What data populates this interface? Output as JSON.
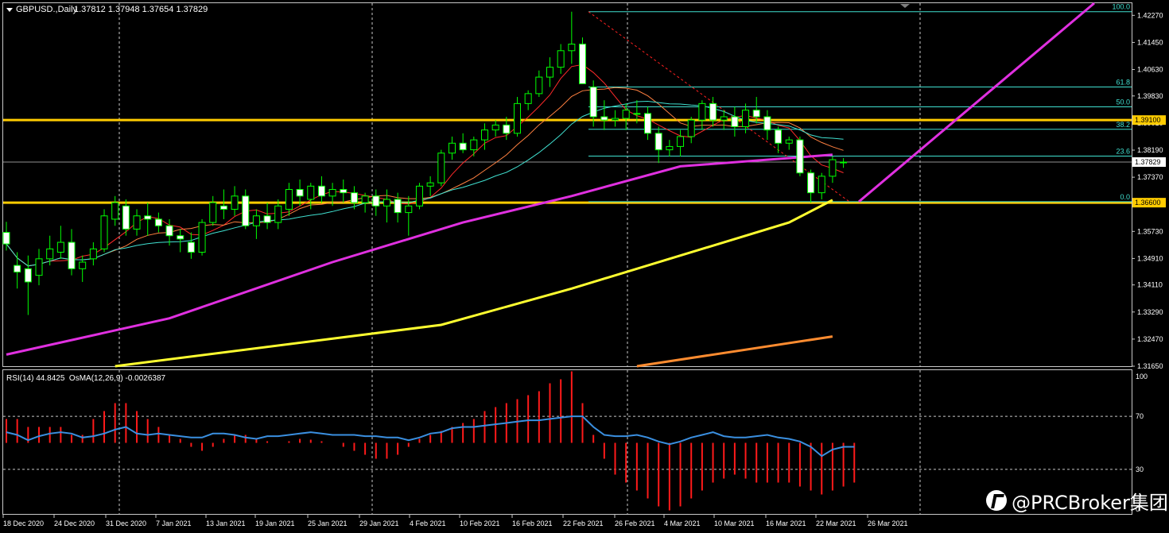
{
  "header": {
    "symbol_label": "GBPUSD.,Daily",
    "ohlc_label": "1.37812 1.37948 1.37654 1.37829"
  },
  "indicator_header": "RSI(14) 44.8425  OsMA(12,26,9) -0.0026387",
  "watermark": "@PRCBroker集团",
  "colors": {
    "background": "#000000",
    "candle_up": "#000000",
    "candle_down": "#ffffff",
    "wick": "#00ff00",
    "ma_fast": "#ff2a2a",
    "ma_mid": "#ff8040",
    "ma_slow_cyan": "#40e0d0",
    "ma_100": "#e030e0",
    "ma_200": "#ffff30",
    "ma_long": "#ff8c30",
    "support_line": "#ffcc00",
    "fib": "#40e0d0",
    "trendline": "#e030e0",
    "rsi": "#3a8fe0",
    "osma": "#ff1a1a",
    "price_tag": "#ffffff"
  },
  "chart_data": {
    "type": "candlestick",
    "symbol": "GBPUSD",
    "timeframe": "Daily",
    "price_axis": {
      "ticks": [
        1.4227,
        1.4145,
        1.4063,
        1.3983,
        1.3901,
        1.3819,
        1.3737,
        1.3655,
        1.3573,
        1.3491,
        1.3411,
        1.3329,
        1.3247,
        1.3165
      ],
      "tick_labels": [
        "1.42270",
        "1.41450",
        "1.40630",
        "1.39830",
        "1.39010",
        "1.38190",
        "1.37370",
        "1.36550",
        "1.35730",
        "1.34910",
        "1.34110",
        "1.33290",
        "1.32470",
        "1.31650"
      ],
      "range": [
        1.3165,
        1.4259
      ]
    },
    "date_labels": [
      "18 Dec 2020",
      "24 Dec 2020",
      "31 Dec 2020",
      "7 Jan 2021",
      "13 Jan 2021",
      "19 Jan 2021",
      "25 Jan 2021",
      "29 Jan 2021",
      "4 Feb 2021",
      "10 Feb 2021",
      "16 Feb 2021",
      "22 Feb 2021",
      "26 Feb 2021",
      "4 Mar 2021",
      "10 Mar 2021",
      "16 Mar 2021",
      "22 Mar 2021",
      "26 Mar 2021"
    ],
    "horizontal_levels": [
      {
        "value": 1.391,
        "label": "1.39100"
      },
      {
        "value": 1.366,
        "label": "1.36600"
      }
    ],
    "current_price": {
      "value": 1.37829,
      "label": "1.37829"
    },
    "fibonacci": {
      "levels": [
        {
          "label": "100.0",
          "value": 1.4238
        },
        {
          "label": "61.8",
          "value": 1.401
        },
        {
          "label": "50.0",
          "value": 1.395
        },
        {
          "label": "38.2",
          "value": 1.3882
        },
        {
          "label": "23.6",
          "value": 1.3801
        },
        {
          "label": "0.0",
          "value": 1.3663
        }
      ]
    },
    "candles": [
      [
        1.357,
        1.3602,
        1.3515,
        1.3535
      ],
      [
        1.347,
        1.351,
        1.34,
        1.345
      ],
      [
        1.346,
        1.35,
        1.332,
        1.342
      ],
      [
        1.344,
        1.352,
        1.341,
        1.349
      ],
      [
        1.349,
        1.356,
        1.347,
        1.352
      ],
      [
        1.351,
        1.359,
        1.349,
        1.354
      ],
      [
        1.354,
        1.358,
        1.344,
        1.346
      ],
      [
        1.346,
        1.35,
        1.342,
        1.348
      ],
      [
        1.349,
        1.354,
        1.347,
        1.352
      ],
      [
        1.352,
        1.364,
        1.351,
        1.362
      ],
      [
        1.361,
        1.368,
        1.359,
        1.366
      ],
      [
        1.365,
        1.367,
        1.356,
        1.358
      ],
      [
        1.358,
        1.364,
        1.356,
        1.362
      ],
      [
        1.362,
        1.366,
        1.356,
        1.361
      ],
      [
        1.361,
        1.363,
        1.357,
        1.359
      ],
      [
        1.359,
        1.361,
        1.353,
        1.356
      ],
      [
        1.356,
        1.358,
        1.351,
        1.355
      ],
      [
        1.354,
        1.357,
        1.349,
        1.351
      ],
      [
        1.351,
        1.361,
        1.35,
        1.36
      ],
      [
        1.36,
        1.368,
        1.359,
        1.366
      ],
      [
        1.365,
        1.37,
        1.361,
        1.364
      ],
      [
        1.364,
        1.371,
        1.362,
        1.368
      ],
      [
        1.368,
        1.37,
        1.358,
        1.359
      ],
      [
        1.359,
        1.364,
        1.355,
        1.362
      ],
      [
        1.362,
        1.366,
        1.358,
        1.36
      ],
      [
        1.36,
        1.367,
        1.358,
        1.365
      ],
      [
        1.364,
        1.372,
        1.362,
        1.37
      ],
      [
        1.37,
        1.373,
        1.365,
        1.368
      ],
      [
        1.367,
        1.372,
        1.364,
        1.371
      ],
      [
        1.371,
        1.374,
        1.366,
        1.368
      ],
      [
        1.368,
        1.372,
        1.365,
        1.37
      ],
      [
        1.37,
        1.373,
        1.366,
        1.369
      ],
      [
        1.369,
        1.371,
        1.364,
        1.366
      ],
      [
        1.366,
        1.369,
        1.363,
        1.368
      ],
      [
        1.368,
        1.37,
        1.362,
        1.365
      ],
      [
        1.365,
        1.37,
        1.36,
        1.367
      ],
      [
        1.367,
        1.369,
        1.36,
        1.363
      ],
      [
        1.363,
        1.368,
        1.356,
        1.365
      ],
      [
        1.365,
        1.372,
        1.364,
        1.371
      ],
      [
        1.371,
        1.374,
        1.368,
        1.372
      ],
      [
        1.372,
        1.382,
        1.371,
        1.381
      ],
      [
        1.381,
        1.386,
        1.379,
        1.384
      ],
      [
        1.384,
        1.387,
        1.381,
        1.382
      ],
      [
        1.382,
        1.386,
        1.38,
        1.385
      ],
      [
        1.385,
        1.39,
        1.382,
        1.388
      ],
      [
        1.388,
        1.391,
        1.386,
        1.3895
      ],
      [
        1.3895,
        1.392,
        1.385,
        1.387
      ],
      [
        1.387,
        1.398,
        1.386,
        1.396
      ],
      [
        1.396,
        1.4,
        1.394,
        1.399
      ],
      [
        1.399,
        1.406,
        1.398,
        1.404
      ],
      [
        1.404,
        1.41,
        1.401,
        1.407
      ],
      [
        1.407,
        1.414,
        1.405,
        1.412
      ],
      [
        1.412,
        1.4238,
        1.408,
        1.414
      ],
      [
        1.414,
        1.416,
        1.403,
        1.402
      ],
      [
        1.401,
        1.403,
        1.389,
        1.392
      ],
      [
        1.392,
        1.397,
        1.388,
        1.391
      ],
      [
        1.391,
        1.394,
        1.389,
        1.3915
      ],
      [
        1.3915,
        1.396,
        1.388,
        1.394
      ],
      [
        1.393,
        1.397,
        1.39,
        1.393
      ],
      [
        1.393,
        1.395,
        1.385,
        1.387
      ],
      [
        1.387,
        1.389,
        1.378,
        1.382
      ],
      [
        1.382,
        1.385,
        1.38,
        1.383
      ],
      [
        1.383,
        1.388,
        1.38,
        1.386
      ],
      [
        1.386,
        1.392,
        1.384,
        1.391
      ],
      [
        1.391,
        1.397,
        1.388,
        1.396
      ],
      [
        1.396,
        1.398,
        1.389,
        1.391
      ],
      [
        1.391,
        1.394,
        1.388,
        1.392
      ],
      [
        1.392,
        1.395,
        1.386,
        1.389
      ],
      [
        1.389,
        1.396,
        1.387,
        1.394
      ],
      [
        1.394,
        1.398,
        1.39,
        1.392
      ],
      [
        1.392,
        1.394,
        1.385,
        1.388
      ],
      [
        1.388,
        1.389,
        1.381,
        1.384
      ],
      [
        1.384,
        1.386,
        1.382,
        1.385
      ],
      [
        1.385,
        1.386,
        1.374,
        1.375
      ],
      [
        1.375,
        1.376,
        1.366,
        1.369
      ],
      [
        1.369,
        1.375,
        1.367,
        1.374
      ],
      [
        1.374,
        1.38,
        1.372,
        1.379
      ],
      [
        1.37812,
        1.37948,
        1.37654,
        1.37829
      ]
    ],
    "moving_averages": [
      {
        "color_key": "ma_200",
        "points": [
          [
            10,
            1.3165
          ],
          [
            40,
            1.329
          ],
          [
            52,
            1.34
          ],
          [
            62,
            1.35
          ],
          [
            72,
            1.36
          ],
          [
            76,
            1.3668
          ]
        ]
      },
      {
        "color_key": "ma_100",
        "points": [
          [
            0,
            1.32
          ],
          [
            15,
            1.331
          ],
          [
            30,
            1.348
          ],
          [
            42,
            1.36
          ],
          [
            52,
            1.368
          ],
          [
            62,
            1.377
          ],
          [
            76,
            1.3805
          ]
        ]
      },
      {
        "color_key": "ma_long",
        "points": [
          [
            58,
            1.3165
          ],
          [
            76,
            1.3255
          ]
        ]
      }
    ]
  },
  "rsi_panel": {
    "tick_labels": [
      "100",
      "70",
      "30",
      "0"
    ],
    "levels": [
      100,
      70,
      30,
      0
    ],
    "rsi_values": [
      58,
      56,
      52,
      55,
      57,
      58,
      57,
      54,
      55,
      57,
      60,
      62,
      57,
      56,
      57,
      56,
      55,
      54,
      54,
      57,
      57,
      56,
      54,
      53,
      55,
      55,
      56,
      57,
      58,
      57,
      56,
      56,
      56,
      55,
      55,
      54,
      54,
      52,
      54,
      57,
      58,
      61,
      62,
      62,
      63,
      64,
      65,
      66,
      67,
      67,
      68,
      69,
      70,
      70,
      62,
      56,
      55,
      55,
      56,
      54,
      51,
      49,
      51,
      54,
      56,
      58,
      55,
      54,
      54,
      55,
      56,
      54,
      53,
      51,
      47,
      40,
      45,
      47,
      47
    ],
    "osma_values": [
      0.3,
      0.3,
      0.2,
      0.2,
      0.2,
      0.2,
      0.1,
      0.1,
      0.3,
      0.4,
      0.5,
      0.5,
      0.4,
      0.3,
      0.2,
      0.1,
      0.05,
      -0.05,
      -0.1,
      -0.05,
      0.05,
      0.1,
      0.1,
      0.05,
      0.02,
      0.0,
      0.02,
      0.05,
      0.04,
      0.02,
      0.0,
      -0.05,
      -0.1,
      -0.15,
      -0.2,
      -0.2,
      -0.15,
      -0.05,
      0.05,
      0.1,
      0.15,
      0.2,
      0.25,
      0.3,
      0.4,
      0.45,
      0.5,
      0.55,
      0.6,
      0.65,
      0.75,
      0.8,
      0.9,
      0.5,
      0.1,
      -0.2,
      -0.4,
      -0.5,
      -0.6,
      -0.7,
      -0.8,
      -0.85,
      -0.8,
      -0.7,
      -0.6,
      -0.5,
      -0.45,
      -0.4,
      -0.45,
      -0.5,
      -0.5,
      -0.5,
      -0.5,
      -0.55,
      -0.6,
      -0.65,
      -0.6,
      -0.55,
      -0.5
    ]
  }
}
